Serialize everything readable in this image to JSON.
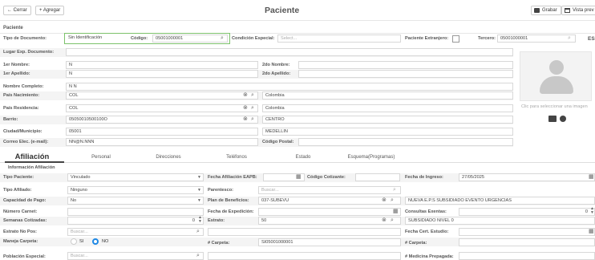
{
  "toolbar": {
    "back_label": "← Cerrar",
    "add_label": "+ Agregar",
    "title": "Paciente",
    "save_label": "Grabar",
    "preview_label": "Vista prev"
  },
  "section_title": "Paciente",
  "form": {
    "tipo_documento_label": "Tipo de Documento:",
    "tipo_documento_value": "Sin Identificación",
    "codigo_label": "Código:",
    "codigo_value": "05001000001",
    "condicion_label": "Condición Especial:",
    "condicion_placeholder": "Select...",
    "extranjero_label": "Paciente Extranjero:",
    "tercero_label": "Tercero:",
    "tercero_value": "05001000001",
    "es_label": "ES",
    "lugar_exp_label": "Lugar Exp. Documento:",
    "nombre1_label": "1er Nombre:",
    "nombre1_value": "N",
    "nombre2_label": "2do Nombre:",
    "apellido1_label": "1er Apellido:",
    "apellido1_value": "N",
    "apellido2_label": "2do Apellido:",
    "nombre_completo_label": "Nombre Completo:",
    "nombre_completo_value": "N  N",
    "pais_nac_label": "País Nacimiento:",
    "pais_nac_code": "COL",
    "pais_nac_name": "Colombia",
    "pais_res_label": "País Residencia:",
    "pais_res_code": "COL",
    "pais_res_name": "Colombia",
    "barrio_label": "Barrio:",
    "barrio_code": "05050010500100O",
    "barrio_name": "CENTRO",
    "ciudad_label": "Ciudad/Municipio:",
    "ciudad_code": "05001",
    "ciudad_name": "MEDELLIN",
    "correo_label": "Correo Elec. (e-mail):",
    "correo_value": "NN@N.NNN",
    "codigo_postal_label": "Código Postal:"
  },
  "photo": {
    "hint": "Clic para seleccionar una imagen"
  },
  "tabs": [
    "Afiliación",
    "Personal",
    "Direcciones",
    "Teléfonos",
    "Estado",
    "Esquema(Programas)"
  ],
  "afiliacion": {
    "section_title": "Información Afiliación",
    "tipo_paciente_label": "Tipo Paciente:",
    "tipo_paciente_value": "Vinculado",
    "fecha_afiliacion_label": "Fecha Afiliación EAPB:",
    "codigo_cotizante_label": "Código Cotizante:",
    "fecha_ingreso_label": "Fecha de Ingreso:",
    "fecha_ingreso_value": "27/05/2025",
    "tipo_afiliado_label": "Tipo Afiliado:",
    "tipo_afiliado_value": "Ninguno",
    "parentesco_label": "Parentesco:",
    "parentesco_placeholder": "Buscar...",
    "capacidad_pago_label": "Capacidad de Pago:",
    "capacidad_pago_value": "No",
    "plan_beneficios_label": "Plan de Beneficios:",
    "plan_beneficios_code": "037-SUBEVU",
    "plan_beneficios_name": "NUEVA E.P.S SUBSIDIADO EVENTO URGENCIAS",
    "numero_carnet_label": "Número Carnet:",
    "fecha_expedicion_label": "Fecha de Expedición:",
    "consultas_exentas_label": "Consultas Exentas:",
    "consultas_exentas_value": "0",
    "semanas_cotizadas_label": "Semanas Cotizadas:",
    "semanas_cotizadas_value": "0",
    "estrato_label": "Estrato:",
    "estrato_code": "50",
    "estrato_name": "SUBSIDIADO NIVEL 0",
    "estrato_no_pos_label": "Estrato No Pos:",
    "estrato_no_pos_placeholder": "Buscar...",
    "fecha_cert_label": "Fecha Cert. Estudio:",
    "maneja_carpeta_label": "Maneja Carpeta:",
    "si_label": "SI",
    "no_label": "NO",
    "num_carpeta_label": "# Carpeta:",
    "num_carpeta_value": "SI05001000001",
    "num_carpeta2_label": "# Carpeta:",
    "poblacion_label": "Población Especial:",
    "poblacion_placeholder": "Buscar...",
    "medicina_prepagada_label": "# Medicina Prepagada:"
  }
}
